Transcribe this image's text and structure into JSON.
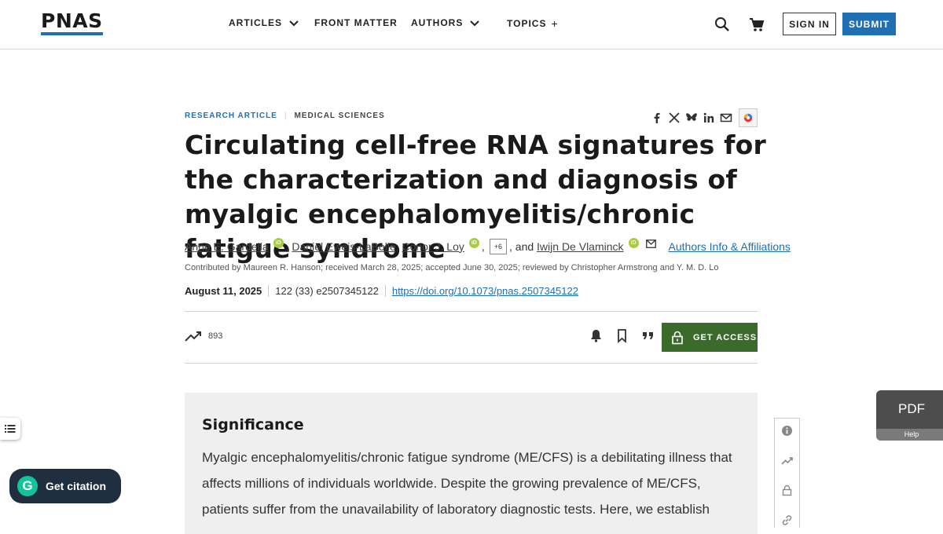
{
  "header": {
    "logo": "PNAS",
    "nav": [
      {
        "label": "ARTICLES",
        "indicator": "chevron-down"
      },
      {
        "label": "FRONT MATTER",
        "indicator": ""
      },
      {
        "label": "AUTHORS",
        "indicator": "chevron-down"
      },
      {
        "label": "TOPICS",
        "indicator": "+"
      }
    ],
    "sign_in": "SIGN IN",
    "submit": "SUBMIT",
    "accent_color": "#1f6fb5"
  },
  "article": {
    "type": "RESEARCH ARTICLE",
    "subject": "MEDICAL SCIENCES",
    "title": "Circulating cell-free RNA signatures for the characterization and diagnosis of myalgic encephalomyelitis/chronic fatigue syndrome",
    "authors": [
      {
        "name": "Anne E. Gardella",
        "orcid": true
      },
      {
        "name": "Daniel Eweis-LaBolle",
        "orcid": false
      },
      {
        "name": "Conor J. Loy",
        "orcid": true
      }
    ],
    "more_authors": "+6",
    "and_text": ", and",
    "last_author": "Iwijn De Vlaminck",
    "affiliations_link": "Authors Info & Affiliations",
    "contributed": "Contributed by Maureen R. Hanson; received March 28, 2025; accepted June 30, 2025; reviewed by Christopher Armstrong and Y. M. D. Lo",
    "date": "August 11, 2025",
    "citation": "122 (33) e2507345122",
    "doi": "https://doi.org/10.1073/pnas.2507345122",
    "metric_count": "893",
    "get_access": "GET ACCESS",
    "access_color": "#3b6b2b"
  },
  "significance": {
    "heading": "Significance",
    "text": "Myalgic encephalomyelitis/chronic fatigue syndrome (ME/CFS) is a debilitating illness that affects millions of individuals worldwide. Despite the growing prevalence of ME/CFS, patients suffer from the unavailability of laboratory diagnostic tests. Here, we establish"
  },
  "widgets": {
    "pdf": "PDF",
    "help": "Help",
    "get_citation": "Get citation"
  }
}
